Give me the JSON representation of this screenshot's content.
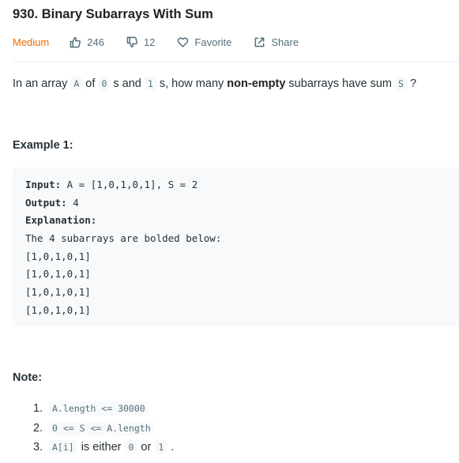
{
  "problem": {
    "title": "930. Binary Subarrays With Sum",
    "difficulty": "Medium",
    "likes": "246",
    "dislikes": "12",
    "favorite_label": "Favorite",
    "share_label": "Share",
    "icons": [
      "thumbs-up-icon",
      "thumbs-down-icon",
      "heart-icon",
      "share-icon"
    ],
    "colors": {
      "difficulty": "#ef6c00",
      "meta": "#546e7a",
      "code_bg": "#f7f9fa"
    }
  },
  "description": {
    "t1": "In an array ",
    "c1": "A",
    "t2": " of ",
    "c2": "0",
    "t3": " s and ",
    "c3": "1",
    "t4": " s, how many ",
    "bold": "non-empty",
    "t5": " subarrays have sum ",
    "c4": "S",
    "t6": " ?"
  },
  "example": {
    "heading": "Example 1:",
    "input_label": "Input:",
    "input_value": " A = [1,0,1,0,1], S = 2",
    "output_label": "Output:",
    "output_value": " 4",
    "explanation_label": "Explanation:",
    "explanation_text": "The 4 subarrays are bolded below:",
    "lines": [
      "[1,0,1,0,1]",
      "[1,0,1,0,1]",
      "[1,0,1,0,1]",
      "[1,0,1,0,1]"
    ]
  },
  "note": {
    "heading": "Note:",
    "items": [
      {
        "num": "1.",
        "code": "A.length <= 30000"
      },
      {
        "num": "2.",
        "code": "0 <= S <= A.length"
      },
      {
        "num": "3.",
        "code_a": "A[i]",
        "text_a": "is either",
        "code_b": "0",
        "text_b": "or",
        "code_c": "1",
        "text_c": "."
      }
    ]
  }
}
